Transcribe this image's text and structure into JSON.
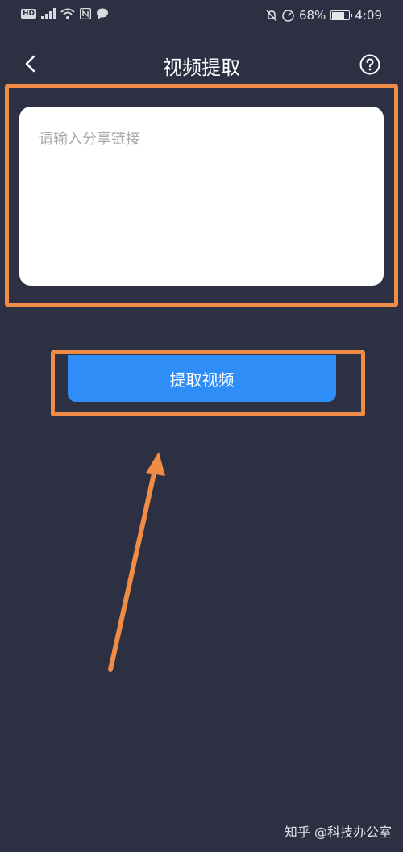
{
  "status_bar": {
    "hd": "HD",
    "battery_text": "68%",
    "time": "4:09"
  },
  "header": {
    "title": "视频提取"
  },
  "input": {
    "placeholder": "请输入分享链接",
    "value": ""
  },
  "extract_button": {
    "label": "提取视频"
  },
  "watermark": {
    "text": "知乎 @科技办公室"
  },
  "icons": {
    "back": "back-arrow-icon",
    "help": "help-circle-icon",
    "wifi": "wifi-icon",
    "nfc": "nfc-icon",
    "signal": "signal-icon",
    "battery": "battery-icon"
  },
  "colors": {
    "background": "#2d2f42",
    "highlight": "#f08c46",
    "button": "#2e8df7",
    "input_bg": "#ffffff",
    "placeholder": "#a8a8ae"
  },
  "battery_level_fraction": 0.68
}
